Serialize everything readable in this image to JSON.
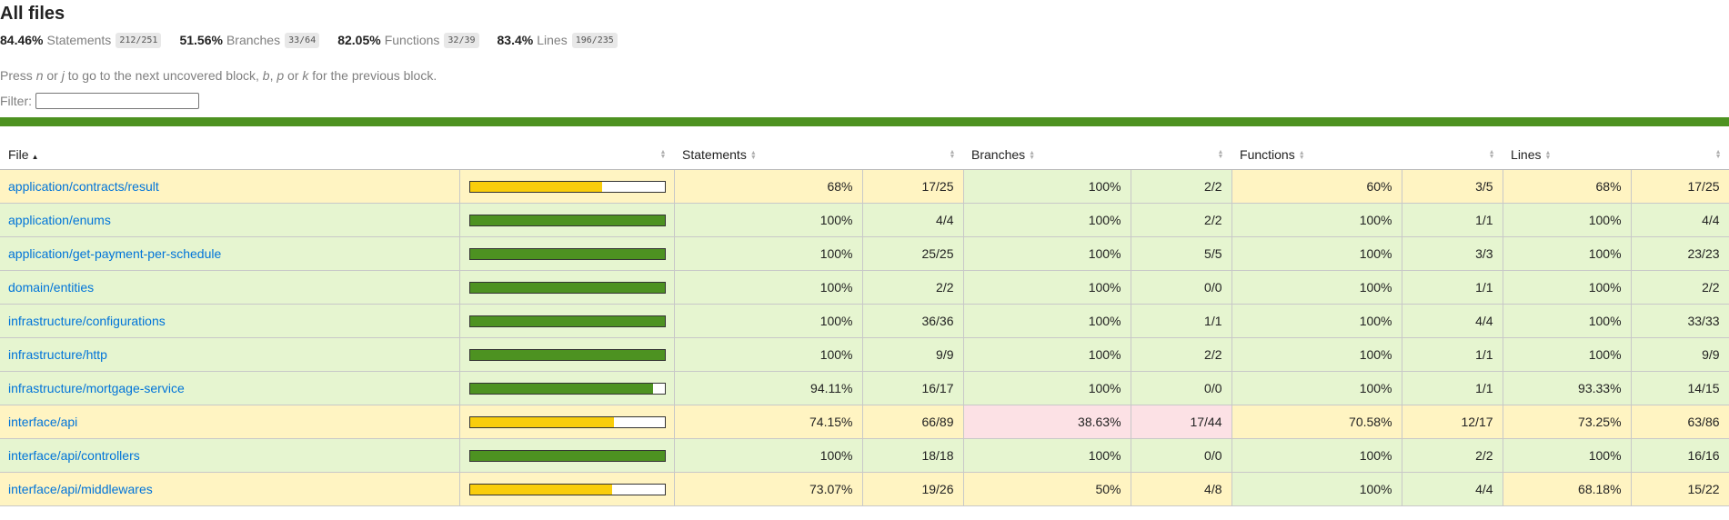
{
  "page": {
    "title": "All files",
    "hint_text": [
      "Press ",
      "n",
      " or ",
      "j",
      " to go to the next uncovered block, ",
      "b",
      ", ",
      "p",
      " or ",
      "k",
      " for the previous block."
    ],
    "filter_label": "Filter:"
  },
  "summary": [
    {
      "pct": "84.46%",
      "label": "Statements",
      "fraction": "212/251"
    },
    {
      "pct": "51.56%",
      "label": "Branches",
      "fraction": "33/64"
    },
    {
      "pct": "82.05%",
      "label": "Functions",
      "fraction": "32/39"
    },
    {
      "pct": "83.4%",
      "label": "Lines",
      "fraction": "196/235"
    }
  ],
  "table": {
    "headers": {
      "file": "File",
      "bar": "",
      "statements": "Statements",
      "branches": "Branches",
      "functions": "Functions",
      "lines": "Lines"
    },
    "rows": [
      {
        "file": "application/contracts/result",
        "level": "medium",
        "bar_pct": 0.68,
        "bar_color": "yellow",
        "s_pct": "68%",
        "s_abs": "17/25",
        "b_pct": "100%",
        "b_abs": "2/2",
        "f_pct": "60%",
        "f_abs": "3/5",
        "l_pct": "68%",
        "l_abs": "17/25",
        "cell_levels": [
          "medium",
          "medium",
          "high",
          "high",
          "medium",
          "medium",
          "medium",
          "medium"
        ]
      },
      {
        "file": "application/enums",
        "level": "high",
        "bar_pct": 1.0,
        "bar_color": "green",
        "s_pct": "100%",
        "s_abs": "4/4",
        "b_pct": "100%",
        "b_abs": "2/2",
        "f_pct": "100%",
        "f_abs": "1/1",
        "l_pct": "100%",
        "l_abs": "4/4",
        "cell_levels": [
          "high",
          "high",
          "high",
          "high",
          "high",
          "high",
          "high",
          "high"
        ]
      },
      {
        "file": "application/get-payment-per-schedule",
        "level": "high",
        "bar_pct": 1.0,
        "bar_color": "green",
        "s_pct": "100%",
        "s_abs": "25/25",
        "b_pct": "100%",
        "b_abs": "5/5",
        "f_pct": "100%",
        "f_abs": "3/3",
        "l_pct": "100%",
        "l_abs": "23/23",
        "cell_levels": [
          "high",
          "high",
          "high",
          "high",
          "high",
          "high",
          "high",
          "high"
        ]
      },
      {
        "file": "domain/entities",
        "level": "high",
        "bar_pct": 1.0,
        "bar_color": "green",
        "s_pct": "100%",
        "s_abs": "2/2",
        "b_pct": "100%",
        "b_abs": "0/0",
        "f_pct": "100%",
        "f_abs": "1/1",
        "l_pct": "100%",
        "l_abs": "2/2",
        "cell_levels": [
          "high",
          "high",
          "high",
          "high",
          "high",
          "high",
          "high",
          "high"
        ]
      },
      {
        "file": "infrastructure/configurations",
        "level": "high",
        "bar_pct": 1.0,
        "bar_color": "green",
        "s_pct": "100%",
        "s_abs": "36/36",
        "b_pct": "100%",
        "b_abs": "1/1",
        "f_pct": "100%",
        "f_abs": "4/4",
        "l_pct": "100%",
        "l_abs": "33/33",
        "cell_levels": [
          "high",
          "high",
          "high",
          "high",
          "high",
          "high",
          "high",
          "high"
        ]
      },
      {
        "file": "infrastructure/http",
        "level": "high",
        "bar_pct": 1.0,
        "bar_color": "green",
        "s_pct": "100%",
        "s_abs": "9/9",
        "b_pct": "100%",
        "b_abs": "2/2",
        "f_pct": "100%",
        "f_abs": "1/1",
        "l_pct": "100%",
        "l_abs": "9/9",
        "cell_levels": [
          "high",
          "high",
          "high",
          "high",
          "high",
          "high",
          "high",
          "high"
        ]
      },
      {
        "file": "infrastructure/mortgage-service",
        "level": "high",
        "bar_pct": 0.9411,
        "bar_color": "green",
        "s_pct": "94.11%",
        "s_abs": "16/17",
        "b_pct": "100%",
        "b_abs": "0/0",
        "f_pct": "100%",
        "f_abs": "1/1",
        "l_pct": "93.33%",
        "l_abs": "14/15",
        "cell_levels": [
          "high",
          "high",
          "high",
          "high",
          "high",
          "high",
          "high",
          "high"
        ]
      },
      {
        "file": "interface/api",
        "level": "medium",
        "bar_pct": 0.7415,
        "bar_color": "yellow",
        "s_pct": "74.15%",
        "s_abs": "66/89",
        "b_pct": "38.63%",
        "b_abs": "17/44",
        "f_pct": "70.58%",
        "f_abs": "12/17",
        "l_pct": "73.25%",
        "l_abs": "63/86",
        "cell_levels": [
          "medium",
          "medium",
          "low",
          "low",
          "medium",
          "medium",
          "medium",
          "medium"
        ]
      },
      {
        "file": "interface/api/controllers",
        "level": "high",
        "bar_pct": 1.0,
        "bar_color": "green",
        "s_pct": "100%",
        "s_abs": "18/18",
        "b_pct": "100%",
        "b_abs": "0/0",
        "f_pct": "100%",
        "f_abs": "2/2",
        "l_pct": "100%",
        "l_abs": "16/16",
        "cell_levels": [
          "high",
          "high",
          "high",
          "high",
          "high",
          "high",
          "high",
          "high"
        ]
      },
      {
        "file": "interface/api/middlewares",
        "level": "medium",
        "bar_pct": 0.7307,
        "bar_color": "yellow",
        "s_pct": "73.07%",
        "s_abs": "19/26",
        "b_pct": "50%",
        "b_abs": "4/8",
        "f_pct": "100%",
        "f_abs": "4/4",
        "l_pct": "68.18%",
        "l_abs": "15/22",
        "cell_levels": [
          "medium",
          "medium",
          "medium",
          "medium",
          "high",
          "high",
          "medium",
          "medium"
        ]
      }
    ]
  },
  "colors": {
    "status_line": "#4d9221",
    "high_bg": "#e6f5d0",
    "medium_bg": "#fff4c2",
    "low_bg": "#fce1e5",
    "link": "#0074d9"
  }
}
